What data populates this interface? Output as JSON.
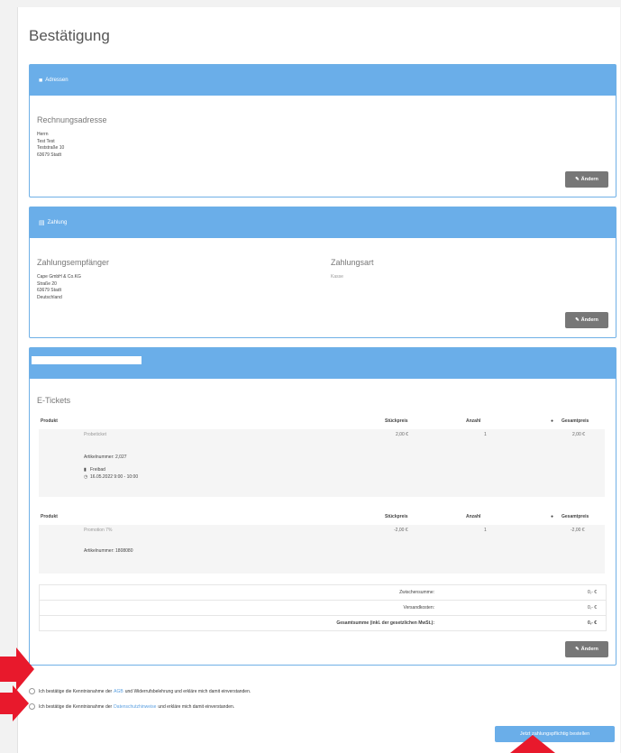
{
  "page": {
    "title": "Bestätigung"
  },
  "address_panel": {
    "header": "Adressen",
    "subtitle": "Rechnungsadresse",
    "lines": [
      "Herrn",
      "Test Test",
      "Teststraße 10",
      "63679 Stadt"
    ],
    "edit_label": "Ändern"
  },
  "payment_panel": {
    "header": "Zahlung",
    "recipient_label": "Zahlungsempfänger",
    "recipient_lines": [
      "Cape GmbH & Co.KG",
      "Straße 20",
      "63679 Stadt",
      "Deutschland"
    ],
    "method_label": "Zahlungsart",
    "method_value": "Kasse",
    "edit_label": "Ändern"
  },
  "order_panel": {
    "section_label": "E-Tickets",
    "columns": [
      "Produkt",
      "Stückpreis",
      "Anzahl",
      "Gesamtpreis"
    ],
    "items": [
      {
        "name": "Probeticket",
        "unit_price": "2,00 €",
        "qty": "1",
        "total": "2,00 €",
        "article": "Artikelnummer: 2,027",
        "extra1": "Freibad",
        "extra2": "16.05.2022 9:00 - 10:00"
      },
      {
        "name": "Promotion 7%",
        "unit_price": "-2,00 €",
        "qty": "1",
        "total": "-2,00 €",
        "article": "Artikelnummer: 1808080"
      }
    ],
    "summary": [
      {
        "label": "Zwischensumme:",
        "value": "0,- €"
      },
      {
        "label": "Versandkosten:",
        "value": "0,- €"
      },
      {
        "label": "Gesamtsumme (inkl. der gesetzlichen MwSt.):",
        "value": "0,- €"
      }
    ],
    "edit_label": "Ändern"
  },
  "consents": [
    {
      "before": "Ich bestätige die Kenntnisnahme der",
      "link": "AGB",
      "after": "und Widerrufsbelehrung und erkläre mich damit einverstanden."
    },
    {
      "before": "Ich bestätige die Kenntnisnahme der",
      "link": "Datenschutzhinweise",
      "after": "und erkläre mich damit einverstanden."
    }
  ],
  "submit_label": "Jetzt zahlungspflichtig bestellen",
  "colors": {
    "accent": "#6aaee9",
    "annotation": "#e8192c"
  }
}
